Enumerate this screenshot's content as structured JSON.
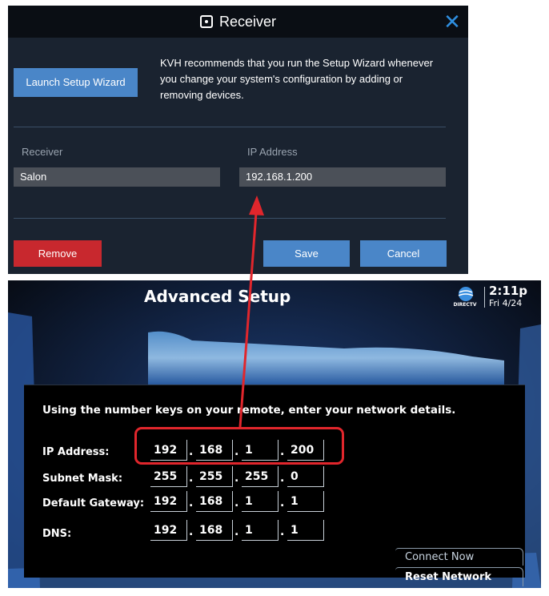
{
  "dialog": {
    "title": "Receiver",
    "close_icon": "close-icon",
    "launch_button": "Launch Setup Wizard",
    "wizard_text": "KVH recommends that you run the Setup Wizard whenever you change your system's configuration by adding or removing devices.",
    "receiver_label": "Receiver",
    "receiver_value": "Salon",
    "ip_label": "IP Address",
    "ip_value": "192.168.1.200",
    "remove_button": "Remove",
    "save_button": "Save",
    "cancel_button": "Cancel",
    "colors": {
      "accent": "#4a86c8",
      "danger": "#c8282e",
      "background": "#1a2330"
    }
  },
  "tv": {
    "title": "Advanced Setup",
    "provider": "DIRECTV",
    "clock_time": "2:11p",
    "clock_date": "Fri 4/24",
    "instructions": "Using the number keys on your remote, enter your network details.",
    "rows": [
      {
        "label": "IP Address:",
        "octets": [
          "192",
          "168",
          "1",
          "200"
        ]
      },
      {
        "label": "Subnet Mask:",
        "octets": [
          "255",
          "255",
          "255",
          "0"
        ]
      },
      {
        "label": "Default Gateway:",
        "octets": [
          "192",
          "168",
          "1",
          "1"
        ]
      },
      {
        "label": "DNS:",
        "octets": [
          "192",
          "168",
          "1",
          "1"
        ]
      }
    ],
    "connect_button": "Connect Now",
    "reset_button": "Reset Network"
  },
  "annotation": {
    "highlight_color": "#e0262c"
  }
}
